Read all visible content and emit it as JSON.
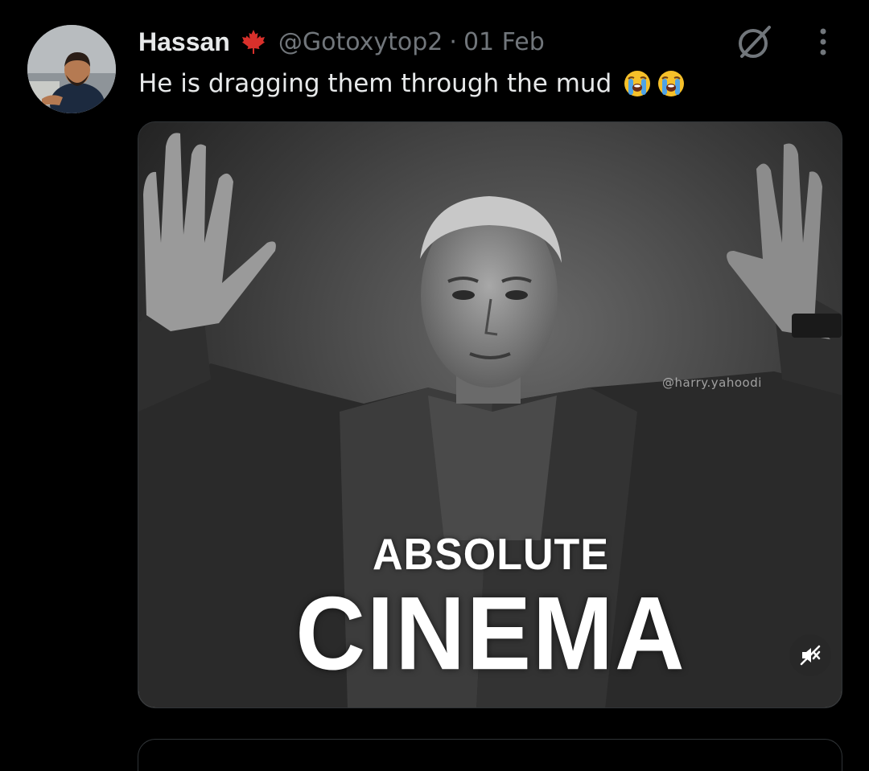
{
  "tweet": {
    "display_name": "Hassan",
    "flag_icon": "maple-leaf-icon",
    "handle": "@Gotoxytop2",
    "separator": "·",
    "date": "01 Feb",
    "text": "He is dragging them through the mud",
    "emoji_icons": [
      "loudly-crying-face-icon",
      "loudly-crying-face-icon"
    ],
    "actions_icons": [
      "grok-icon",
      "more-options-icon"
    ]
  },
  "media": {
    "watermark": "@harry.yahoodi",
    "caption_top": "ABSOLUTE",
    "caption_bottom": "CINEMA",
    "mute_icon": "volume-muted-icon"
  },
  "colors": {
    "background": "#000000",
    "primary_text": "#e7e9ea",
    "secondary_text": "#71767b",
    "flag_red": "#d9302b",
    "border": "#2f3336"
  }
}
